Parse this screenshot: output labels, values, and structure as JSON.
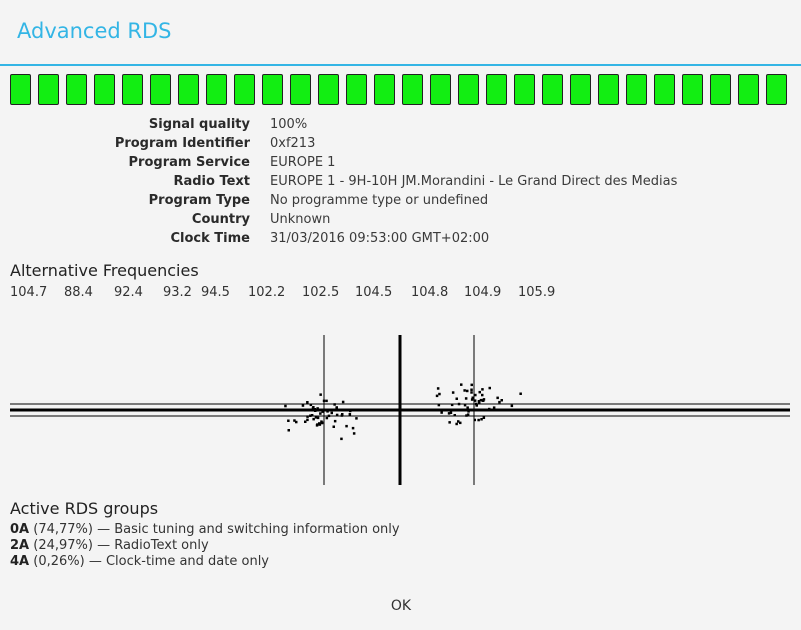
{
  "dialog": {
    "title": "Advanced RDS",
    "ok_label": "OK"
  },
  "colors": {
    "accent": "#33b5e5",
    "signal_bar": "#12ee12"
  },
  "signal": {
    "quality_percent": 100,
    "bar_count": 28,
    "bars_lit": 28
  },
  "info": [
    {
      "label": "Signal quality",
      "value": "100%"
    },
    {
      "label": "Program Identifier",
      "value": "0xf213"
    },
    {
      "label": "Program Service",
      "value": "EUROPE 1"
    },
    {
      "label": "Radio Text",
      "value": "EUROPE 1 - 9H-10H JM.Morandini - Le Grand Direct des Medias"
    },
    {
      "label": "Program Type",
      "value": "No programme type or undefined"
    },
    {
      "label": "Country",
      "value": "Unknown"
    },
    {
      "label": "Clock Time",
      "value": "31/03/2016 09:53:00 GMT+02:00"
    }
  ],
  "alternative_frequencies": {
    "heading": "Alternative Frequencies",
    "items": [
      "104.7",
      "88.4",
      "92.4",
      "93.2",
      "94.5",
      "102.2",
      "102.5",
      "104.5",
      "104.8",
      "104.9",
      "105.9"
    ]
  },
  "active_groups": {
    "heading": "Active RDS groups",
    "items": [
      {
        "code": "0A",
        "detail": " (74,77%) — Basic tuning and switching information only"
      },
      {
        "code": "2A",
        "detail": " (24,97%) — RadioText only"
      },
      {
        "code": "4A",
        "detail": " (0,26%) — Clock-time and date only"
      }
    ]
  }
}
